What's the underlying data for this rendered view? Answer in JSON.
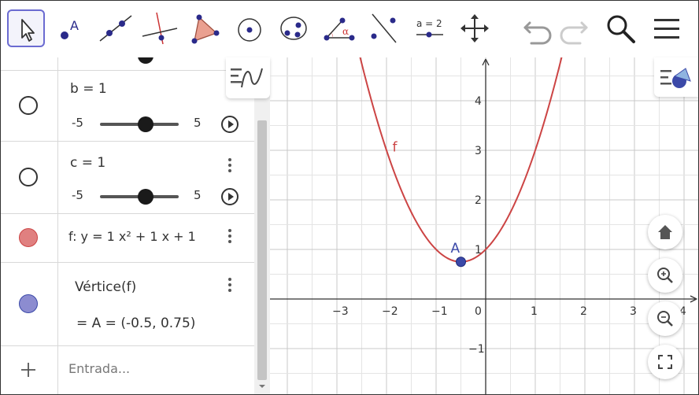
{
  "toolbar": {
    "tools": [
      {
        "name": "move-tool",
        "icon": "cursor-arrow-icon",
        "active": true
      },
      {
        "name": "point-tool",
        "icon": "point-icon",
        "label": "A"
      },
      {
        "name": "line-tool",
        "icon": "line-through-points-icon"
      },
      {
        "name": "perpendicular-tool",
        "icon": "perpendicular-lines-icon"
      },
      {
        "name": "polygon-tool",
        "icon": "polygon-icon"
      },
      {
        "name": "circle-center-tool",
        "icon": "circle-center-icon"
      },
      {
        "name": "circle-three-points-tool",
        "icon": "circle-three-points-icon"
      },
      {
        "name": "angle-tool",
        "icon": "angle-icon",
        "label": "α"
      },
      {
        "name": "reflect-tool",
        "icon": "reflect-line-icon"
      },
      {
        "name": "slider-tool",
        "icon": "slider-icon",
        "label": "a = 2"
      },
      {
        "name": "move-view-tool",
        "icon": "move-graphics-icon"
      }
    ],
    "undo_icon": "undo-icon",
    "redo_icon": "redo-icon",
    "search_icon": "search-icon",
    "menu_icon": "hamburger-menu-icon"
  },
  "algebra": {
    "rows": [
      {
        "type": "slider",
        "label": "b = 1",
        "min": "-5",
        "max": "5",
        "value": 1,
        "range": [
          -5,
          5
        ],
        "color": "#ffffff"
      },
      {
        "type": "slider",
        "label": "c = 1",
        "min": "-5",
        "max": "5",
        "value": 1,
        "range": [
          -5,
          5
        ],
        "color": "#ffffff"
      },
      {
        "type": "function",
        "label": "f: y = 1 x² + 1 x + 1",
        "color": "#e08080"
      },
      {
        "type": "vertex",
        "label": "Vértice(f)",
        "value": "= A = (-0.5, 0.75)",
        "color": "#8c8cd0"
      }
    ],
    "input": {
      "plus_icon": "plus-icon",
      "placeholder": "Entrada..."
    }
  },
  "graphics": {
    "x_ticks": [
      "−3",
      "−2",
      "−1",
      "0",
      "1",
      "2",
      "3",
      "4"
    ],
    "y_ticks": [
      "4",
      "3",
      "2",
      "1",
      "−1"
    ],
    "function_label": "f",
    "point_label": "A",
    "point": [
      -0.5,
      0.75
    ],
    "curve_color": "#cc4444",
    "point_color": "#3b49a8",
    "coeffs": {
      "a": 1,
      "b": 1,
      "c": 1
    },
    "buttons": [
      "home-icon",
      "zoom-in-icon",
      "zoom-out-icon",
      "fullscreen-icon"
    ]
  }
}
